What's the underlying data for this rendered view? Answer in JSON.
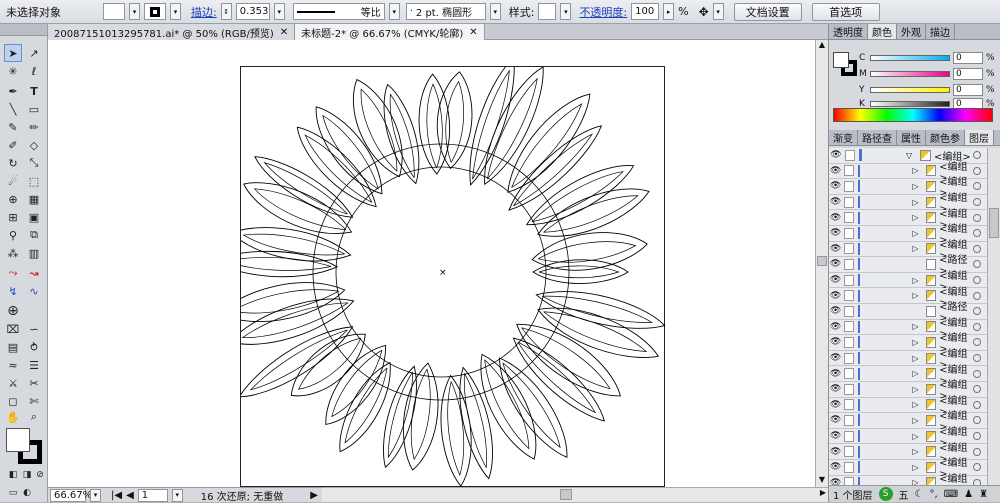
{
  "control_bar": {
    "selection_status": "未选择对象",
    "stroke_label": "描边:",
    "stroke_weight": "0.353",
    "stroke_profile": "等比",
    "brush_label": "2 pt. 椭圆形",
    "style_label": "样式:",
    "opacity_label": "不透明度:",
    "opacity_value": "100",
    "opacity_unit": "%",
    "doc_setup_button": "文档设置",
    "preferences_button": "首选项"
  },
  "tabs": [
    {
      "label": "20087151013295781.ai* @ 50% (RGB/预览)",
      "close": "✕"
    },
    {
      "label": "未标题-2* @ 66.67% (CMYK/轮廓)",
      "close": "✕"
    }
  ],
  "status_bar": {
    "zoom": "66.67%",
    "page": "1",
    "undo_info": "16 次还原; 无重做"
  },
  "color_panel": {
    "tabs": [
      "透明度",
      "颜色",
      "外观",
      "描边"
    ],
    "channels": [
      {
        "name": "C",
        "value": "0",
        "color": "#00aeef"
      },
      {
        "name": "M",
        "value": "0",
        "color": "#ec008c"
      },
      {
        "name": "Y",
        "value": "0",
        "color": "#fff200"
      },
      {
        "name": "K",
        "value": "0",
        "color": "#231f20"
      }
    ],
    "unit": "%"
  },
  "layers_panel": {
    "tabs": [
      "渐变",
      "路径查",
      "属性",
      "颜色参",
      "图层"
    ],
    "rows": [
      {
        "name": "<编组>",
        "expanded": true
      },
      {
        "name": "<编组>"
      },
      {
        "name": "<编组>"
      },
      {
        "name": "<编组>"
      },
      {
        "name": "<编组>"
      },
      {
        "name": "<编组>"
      },
      {
        "name": "<编组>"
      },
      {
        "name": "<路径>"
      },
      {
        "name": "<编组>"
      },
      {
        "name": "<编组>"
      },
      {
        "name": "<路径>"
      },
      {
        "name": "<编组>"
      },
      {
        "name": "<编组>"
      },
      {
        "name": "<编组>"
      },
      {
        "name": "<编组>"
      },
      {
        "name": "<编组>"
      },
      {
        "name": "<编组>"
      },
      {
        "name": "<编组>"
      },
      {
        "name": "<编组>"
      },
      {
        "name": "<编组>"
      },
      {
        "name": "<编组>"
      },
      {
        "name": "<编组>"
      }
    ],
    "footer": "1 个图层"
  },
  "ime_label": "五"
}
